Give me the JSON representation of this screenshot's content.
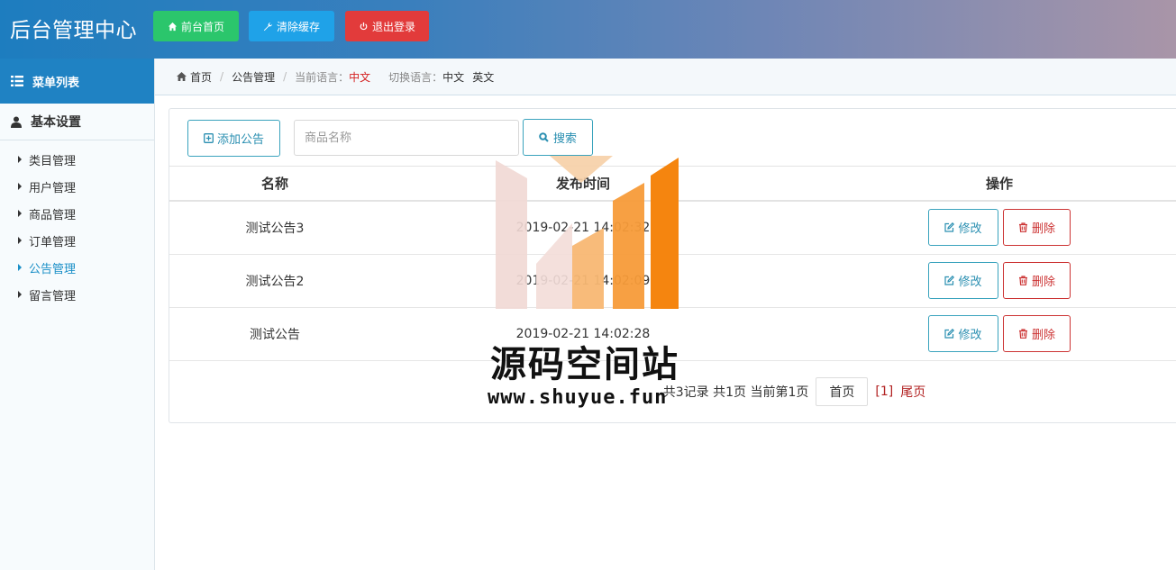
{
  "header": {
    "title": "后台管理中心",
    "home_label": "前台首页",
    "clear_cache_label": "清除缓存",
    "logout_label": "退出登录"
  },
  "sidebar": {
    "menu_title": "菜单列表",
    "group_title": "基本设置",
    "items": [
      {
        "label": "类目管理"
      },
      {
        "label": "用户管理"
      },
      {
        "label": "商品管理"
      },
      {
        "label": "订单管理"
      },
      {
        "label": "公告管理",
        "active": true
      },
      {
        "label": "留言管理"
      }
    ]
  },
  "breadcrumb": {
    "home": "首页",
    "section": "公告管理",
    "current_lang_label": "当前语言：",
    "current_lang": "中文",
    "switch_label": "切换语言：",
    "lang_cn": "中文",
    "lang_en": "英文"
  },
  "toolbar": {
    "add_label": "添加公告",
    "search_placeholder": "商品名称",
    "search_label": "搜索"
  },
  "table": {
    "headers": [
      "名称",
      "发布时间",
      "操作"
    ],
    "edit_label": "修改",
    "delete_label": "删除",
    "rows": [
      {
        "name": "测试公告3",
        "time": "2019-02-21 14:02:32"
      },
      {
        "name": "测试公告2",
        "time": "2019-02-21 14:02:09"
      },
      {
        "name": "测试公告",
        "time": "2019-02-21 14:02:28"
      }
    ]
  },
  "pager": {
    "summary": "共3记录 共1页 当前第1页",
    "first": "首页",
    "current": "[1]",
    "last": "尾页"
  },
  "watermark": {
    "title": "源码空间站",
    "url": "www.shuyue.fun"
  },
  "colors": {
    "header_start": "#1d7dbf",
    "header_end": "#a995a8",
    "home_button": "#2bc66c",
    "clear_button": "#1fa2e8",
    "logout_button": "#e23b3b",
    "accent": "#2a8fb1",
    "danger": "#cc3333"
  }
}
